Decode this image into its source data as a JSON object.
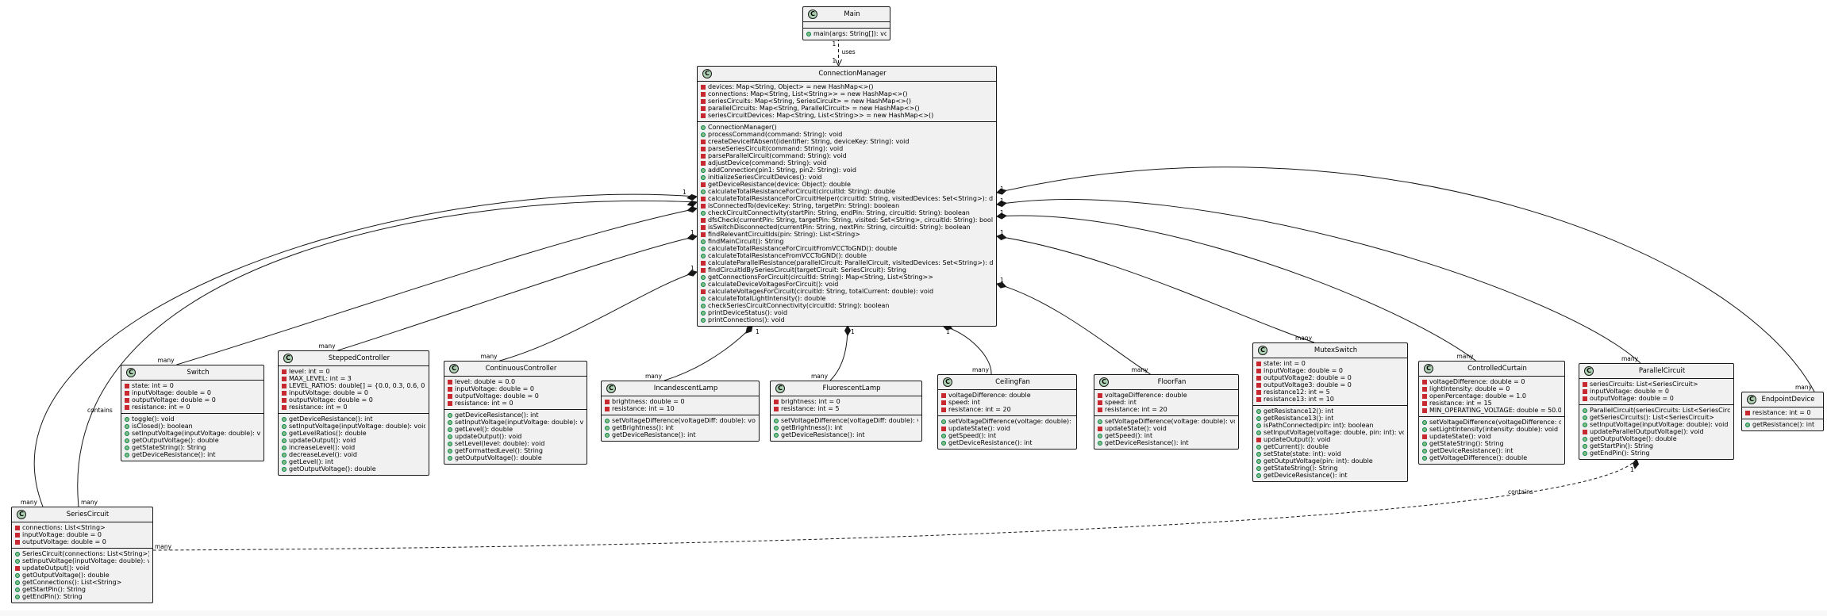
{
  "diagram": {
    "classes": [
      {
        "id": "Main",
        "name": "Main",
        "fields": [],
        "methods": [
          {
            "v": "+",
            "t": "main(args: String[]): void"
          }
        ]
      },
      {
        "id": "ConnectionManager",
        "name": "ConnectionManager",
        "fields": [
          {
            "v": "-",
            "t": "devices: Map<String, Object> = new HashMap<>()"
          },
          {
            "v": "-",
            "t": "connections: Map<String, List<String>> = new HashMap<>()"
          },
          {
            "v": "-",
            "t": "seriesCircuits: Map<String, SeriesCircuit> = new HashMap<>()"
          },
          {
            "v": "-",
            "t": "parallelCircuits: Map<String, ParallelCircuit> = new HashMap<>()"
          },
          {
            "v": "-",
            "t": "seriesCircuitDevices: Map<String, List<String>> = new HashMap<>()"
          }
        ],
        "methods": [
          {
            "v": "+",
            "t": "ConnectionManager()"
          },
          {
            "v": "+",
            "t": "processCommand(command: String): void"
          },
          {
            "v": "-",
            "t": "createDeviceIfAbsent(identifier: String, deviceKey: String): void"
          },
          {
            "v": "-",
            "t": "parseSeriesCircuit(command: String): void"
          },
          {
            "v": "-",
            "t": "parseParallelCircuit(command: String): void"
          },
          {
            "v": "-",
            "t": "adjustDevice(command: String): void"
          },
          {
            "v": "+",
            "t": "addConnection(pin1: String, pin2: String): void"
          },
          {
            "v": "+",
            "t": "initializeSeriesCircuitDevices(): void"
          },
          {
            "v": "-",
            "t": "getDeviceResistance(device: Object): double"
          },
          {
            "v": "+",
            "t": "calculateTotalResistanceForCircuit(circuitId: String): double"
          },
          {
            "v": "-",
            "t": "calculateTotalResistanceForCircuitHelper(circuitId: String, visitedDevices: Set<String>): double"
          },
          {
            "v": "-",
            "t": "isConnectedTo(deviceKey: String, targetPin: String): boolean"
          },
          {
            "v": "+",
            "t": "checkCircuitConnectivity(startPin: String, endPin: String, circuitId: String): boolean"
          },
          {
            "v": "-",
            "t": "dfsCheck(currentPin: String, targetPin: String, visited: Set<String>, circuitId: String): boolean"
          },
          {
            "v": "-",
            "t": "isSwitchDisconnected(currentPin: String, nextPin: String, circuitId: String): boolean"
          },
          {
            "v": "-",
            "t": "findRelevantCircuitIds(pin: String): List<String>"
          },
          {
            "v": "+",
            "t": "findMainCircuit(): String"
          },
          {
            "v": "+",
            "t": "calculateTotalResistanceForCircuitFromVCCToGND(): double"
          },
          {
            "v": "+",
            "t": "calculateTotalResistanceFromVCCToGND(): double"
          },
          {
            "v": "-",
            "t": "calculateParallelResistance(parallelCircuit: ParallelCircuit, visitedDevices: Set<String>): double"
          },
          {
            "v": "-",
            "t": "findCircuitIdBySeriesCircuit(targetCircuit: SeriesCircuit): String"
          },
          {
            "v": "+",
            "t": "getConnectionsForCircuit(circuitId: String): Map<String, List<String>>"
          },
          {
            "v": "+",
            "t": "calculateDeviceVoltagesForCircuit(): void"
          },
          {
            "v": "-",
            "t": "calculateVoltagesForCircuit(circuitId: String, totalCurrent: double): void"
          },
          {
            "v": "+",
            "t": "calculateTotalLightIntensity(): double"
          },
          {
            "v": "+",
            "t": "checkSeriesCircuitConnectivity(circuitId: String): boolean"
          },
          {
            "v": "+",
            "t": "printDeviceStatus(): void"
          },
          {
            "v": "+",
            "t": "printConnections(): void"
          }
        ]
      },
      {
        "id": "Switch",
        "name": "Switch",
        "fields": [
          {
            "v": "-",
            "t": "state: int = 0"
          },
          {
            "v": "-",
            "t": "inputVoltage: double = 0"
          },
          {
            "v": "-",
            "t": "outputVoltage: double = 0"
          },
          {
            "v": "-",
            "t": "resistance: int = 0"
          }
        ],
        "methods": [
          {
            "v": "+",
            "t": "toggle(): void"
          },
          {
            "v": "+",
            "t": "isClosed(): boolean"
          },
          {
            "v": "+",
            "t": "setInputVoltage(inputVoltage: double): void"
          },
          {
            "v": "+",
            "t": "getOutputVoltage(): double"
          },
          {
            "v": "+",
            "t": "getStateString(): String"
          },
          {
            "v": "+",
            "t": "getDeviceResistance(): int"
          }
        ]
      },
      {
        "id": "SteppedController",
        "name": "SteppedController",
        "fields": [
          {
            "v": "-",
            "t": "level: int = 0"
          },
          {
            "v": "-",
            "t": "MAX_LEVEL: int = 3"
          },
          {
            "v": "-",
            "t": "LEVEL_RATIOS: double[] = {0.0, 0.3, 0.6, 0.9}"
          },
          {
            "v": "-",
            "t": "inputVoltage: double = 0"
          },
          {
            "v": "-",
            "t": "outputVoltage: double = 0"
          },
          {
            "v": "-",
            "t": "resistance: int = 0"
          }
        ],
        "methods": [
          {
            "v": "+",
            "t": "getDeviceResistance(): int"
          },
          {
            "v": "+",
            "t": "setInputVoltage(inputVoltage: double): void"
          },
          {
            "v": "+",
            "t": "getLevelRatios(): double"
          },
          {
            "v": "+",
            "t": "updateOutput(): void"
          },
          {
            "v": "+",
            "t": "increaseLevel(): void"
          },
          {
            "v": "+",
            "t": "decreaseLevel(): void"
          },
          {
            "v": "+",
            "t": "getLevel(): int"
          },
          {
            "v": "+",
            "t": "getOutputVoltage(): double"
          }
        ]
      },
      {
        "id": "ContinuousController",
        "name": "ContinuousController",
        "fields": [
          {
            "v": "-",
            "t": "level: double = 0.0"
          },
          {
            "v": "-",
            "t": "inputVoltage: double = 0"
          },
          {
            "v": "-",
            "t": "outputVoltage: double = 0"
          },
          {
            "v": "-",
            "t": "resistance: int = 0"
          }
        ],
        "methods": [
          {
            "v": "+",
            "t": "getDeviceResistance(): int"
          },
          {
            "v": "+",
            "t": "setInputVoltage(inputVoltage: double): void"
          },
          {
            "v": "+",
            "t": "getLevel(): double"
          },
          {
            "v": "+",
            "t": "updateOutput(): void"
          },
          {
            "v": "+",
            "t": "setLevel(level: double): void"
          },
          {
            "v": "+",
            "t": "getFormattedLevel(): String"
          },
          {
            "v": "+",
            "t": "getOutputVoltage(): double"
          }
        ]
      },
      {
        "id": "IncandescentLamp",
        "name": "IncandescentLamp",
        "fields": [
          {
            "v": "-",
            "t": "brightness: double = 0"
          },
          {
            "v": "-",
            "t": "resistance: int = 10"
          }
        ],
        "methods": [
          {
            "v": "+",
            "t": "setVoltageDifference(voltageDiff: double): void"
          },
          {
            "v": "+",
            "t": "getBrightness(): int"
          },
          {
            "v": "+",
            "t": "getDeviceResistance(): int"
          }
        ]
      },
      {
        "id": "FluorescentLamp",
        "name": "FluorescentLamp",
        "fields": [
          {
            "v": "-",
            "t": "brightness: int = 0"
          },
          {
            "v": "-",
            "t": "resistance: int = 5"
          }
        ],
        "methods": [
          {
            "v": "+",
            "t": "setVoltageDifference(voltageDiff: double): void"
          },
          {
            "v": "+",
            "t": "getBrightness(): int"
          },
          {
            "v": "+",
            "t": "getDeviceResistance(): int"
          }
        ]
      },
      {
        "id": "CeilingFan",
        "name": "CeilingFan",
        "fields": [
          {
            "v": "-",
            "t": "voltageDifference: double"
          },
          {
            "v": "-",
            "t": "speed: int"
          },
          {
            "v": "-",
            "t": "resistance: int = 20"
          }
        ],
        "methods": [
          {
            "v": "+",
            "t": "setVoltageDifference(voltage: double): void"
          },
          {
            "v": "-",
            "t": "updateState(): void"
          },
          {
            "v": "+",
            "t": "getSpeed(): int"
          },
          {
            "v": "+",
            "t": "getDeviceResistance(): int"
          }
        ]
      },
      {
        "id": "FloorFan",
        "name": "FloorFan",
        "fields": [
          {
            "v": "-",
            "t": "voltageDifference: double"
          },
          {
            "v": "-",
            "t": "speed: int"
          },
          {
            "v": "-",
            "t": "resistance: int = 20"
          }
        ],
        "methods": [
          {
            "v": "+",
            "t": "setVoltageDifference(voltage: double): void"
          },
          {
            "v": "-",
            "t": "updateState(): void"
          },
          {
            "v": "+",
            "t": "getSpeed(): int"
          },
          {
            "v": "+",
            "t": "getDeviceResistance(): int"
          }
        ]
      },
      {
        "id": "MutexSwitch",
        "name": "MutexSwitch",
        "fields": [
          {
            "v": "-",
            "t": "state: int = 0"
          },
          {
            "v": "-",
            "t": "inputVoltage: double = 0"
          },
          {
            "v": "-",
            "t": "outputVoltage2: double = 0"
          },
          {
            "v": "-",
            "t": "outputVoltage3: double = 0"
          },
          {
            "v": "-",
            "t": "resistance12: int = 5"
          },
          {
            "v": "-",
            "t": "resistance13: int = 10"
          }
        ],
        "methods": [
          {
            "v": "+",
            "t": "getResistance12(): int"
          },
          {
            "v": "+",
            "t": "getResistance13(): int"
          },
          {
            "v": "+",
            "t": "isPathConnected(pin: int): boolean"
          },
          {
            "v": "+",
            "t": "setInputVoltage(voltage: double, pin: int): void"
          },
          {
            "v": "-",
            "t": "updateOutput(): void"
          },
          {
            "v": "+",
            "t": "getCurrent(): double"
          },
          {
            "v": "+",
            "t": "setState(state: int): void"
          },
          {
            "v": "+",
            "t": "getOutputVoltage(pin: int): double"
          },
          {
            "v": "+",
            "t": "getStateString(): String"
          },
          {
            "v": "+",
            "t": "getDeviceResistance(): int"
          }
        ]
      },
      {
        "id": "ControlledCurtain",
        "name": "ControlledCurtain",
        "fields": [
          {
            "v": "-",
            "t": "voltageDifference: double = 0"
          },
          {
            "v": "-",
            "t": "lightIntensity: double = 0"
          },
          {
            "v": "-",
            "t": "openPercentage: double = 1.0"
          },
          {
            "v": "-",
            "t": "resistance: int = 15"
          },
          {
            "v": "-",
            "t": "MIN_OPERATING_VOLTAGE: double = 50.0"
          }
        ],
        "methods": [
          {
            "v": "+",
            "t": "setVoltageDifference(voltageDifference: double): void"
          },
          {
            "v": "+",
            "t": "setLightIntensity(intensity: double): void"
          },
          {
            "v": "-",
            "t": "updateState(): void"
          },
          {
            "v": "+",
            "t": "getStateString(): String"
          },
          {
            "v": "+",
            "t": "getDeviceResistance(): int"
          },
          {
            "v": "+",
            "t": "getVoltageDifference(): double"
          }
        ]
      },
      {
        "id": "ParallelCircuit",
        "name": "ParallelCircuit",
        "fields": [
          {
            "v": "-",
            "t": "seriesCircuits: List<SeriesCircuit>"
          },
          {
            "v": "-",
            "t": "inputVoltage: double = 0"
          },
          {
            "v": "-",
            "t": "outputVoltage: double = 0"
          }
        ],
        "methods": [
          {
            "v": "+",
            "t": "ParallelCircuit(seriesCircuits: List<SeriesCircuit>)"
          },
          {
            "v": "+",
            "t": "getSeriesCircuits(): List<SeriesCircuit>"
          },
          {
            "v": "+",
            "t": "setInputVoltage(inputVoltage: double): void"
          },
          {
            "v": "-",
            "t": "updateParallelOutputVoltage(): void"
          },
          {
            "v": "+",
            "t": "getOutputVoltage(): double"
          },
          {
            "v": "+",
            "t": "getStartPin(): String"
          },
          {
            "v": "+",
            "t": "getEndPin(): String"
          }
        ]
      },
      {
        "id": "EndpointDevice",
        "name": "EndpointDevice",
        "fields": [
          {
            "v": "-",
            "t": "resistance: int = 0"
          }
        ],
        "methods": [
          {
            "v": "+",
            "t": "getResistance(): int"
          }
        ]
      },
      {
        "id": "SeriesCircuit",
        "name": "SeriesCircuit",
        "fields": [
          {
            "v": "-",
            "t": "connections: List<String>"
          },
          {
            "v": "-",
            "t": "inputVoltage: double = 0"
          },
          {
            "v": "-",
            "t": "outputVoltage: double = 0"
          }
        ],
        "methods": [
          {
            "v": "+",
            "t": "SeriesCircuit(connections: List<String>)"
          },
          {
            "v": "+",
            "t": "setInputVoltage(inputVoltage: double): void"
          },
          {
            "v": "-",
            "t": "updateOutput(): void"
          },
          {
            "v": "+",
            "t": "getOutputVoltage(): double"
          },
          {
            "v": "+",
            "t": "getConnections(): List<String>"
          },
          {
            "v": "+",
            "t": "getStartPin(): String"
          },
          {
            "v": "+",
            "t": "getEndPin(): String"
          }
        ]
      }
    ],
    "relations": [
      {
        "from": "Main",
        "to": "ConnectionManager",
        "kind": "dependency",
        "label": "uses",
        "from_mult": "1",
        "to_mult": "1"
      },
      {
        "from": "ConnectionManager",
        "to": "SeriesCircuit",
        "kind": "composition",
        "label": "contains",
        "from_mult": "1",
        "to_mult": "many"
      },
      {
        "from": "ConnectionManager",
        "to": "SeriesCircuit",
        "kind": "composition",
        "label": "",
        "from_mult": "1",
        "to_mult": "many"
      },
      {
        "from": "ConnectionManager",
        "to": "Switch",
        "kind": "composition",
        "label": "",
        "from_mult": "1",
        "to_mult": "many"
      },
      {
        "from": "ConnectionManager",
        "to": "SteppedController",
        "kind": "composition",
        "label": "",
        "from_mult": "1",
        "to_mult": "many"
      },
      {
        "from": "ConnectionManager",
        "to": "ContinuousController",
        "kind": "composition",
        "label": "",
        "from_mult": "1",
        "to_mult": "many"
      },
      {
        "from": "ConnectionManager",
        "to": "IncandescentLamp",
        "kind": "composition",
        "label": "",
        "from_mult": "1",
        "to_mult": "many"
      },
      {
        "from": "ConnectionManager",
        "to": "FluorescentLamp",
        "kind": "composition",
        "label": "",
        "from_mult": "1",
        "to_mult": "many"
      },
      {
        "from": "ConnectionManager",
        "to": "CeilingFan",
        "kind": "composition",
        "label": "",
        "from_mult": "1",
        "to_mult": "many"
      },
      {
        "from": "ConnectionManager",
        "to": "FloorFan",
        "kind": "composition",
        "label": "",
        "from_mult": "1",
        "to_mult": "many"
      },
      {
        "from": "ConnectionManager",
        "to": "MutexSwitch",
        "kind": "composition",
        "label": "",
        "from_mult": "1",
        "to_mult": "many"
      },
      {
        "from": "ConnectionManager",
        "to": "ControlledCurtain",
        "kind": "composition",
        "label": "",
        "from_mult": "1",
        "to_mult": "many"
      },
      {
        "from": "ConnectionManager",
        "to": "ParallelCircuit",
        "kind": "composition",
        "label": "",
        "from_mult": "1",
        "to_mult": "many"
      },
      {
        "from": "ConnectionManager",
        "to": "EndpointDevice",
        "kind": "composition",
        "label": "",
        "from_mult": "1",
        "to_mult": "many"
      },
      {
        "from": "ParallelCircuit",
        "to": "SeriesCircuit",
        "kind": "composition",
        "label": "contains",
        "from_mult": "1",
        "to_mult": "many"
      }
    ]
  },
  "colors": {
    "class_fill": "#f1f1f1",
    "class_icon": "#add1b2",
    "border": "#181818",
    "public_marker": "#84be84",
    "private_marker": "#c82930"
  }
}
